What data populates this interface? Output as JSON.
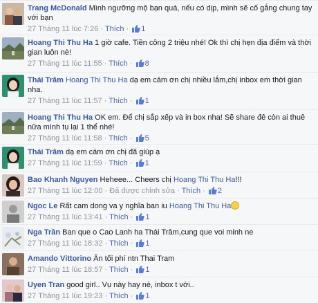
{
  "comments": [
    {
      "author": "Trang McDonald",
      "text": "Mình ngưỡng mộ bạn quá, nếu có dịp, mình sẽ cố gắng chung tay với bạn",
      "timestamp": "27 Tháng 11 lúc 7:26",
      "like_label": "Thích",
      "like_count": "1",
      "avatar_icon": "profile-photo-couple",
      "avatar_color": "#8a5a44"
    },
    {
      "author": "Hoang Thi Thu Ha",
      "text": "1 giờ cafe. Tiền công 2 triệu nhé! Ok thì chị hẹn địa điểm và thời gian luôn nè!",
      "timestamp": "27 Tháng 11 lúc 11:55",
      "like_label": "Thích",
      "like_count": "8",
      "avatar_icon": "profile-photo-landscape",
      "avatar_color": "#6f7f5a"
    },
    {
      "author": "Thái Trâm",
      "mention": "Hoang Thi Thu Ha",
      "text": "dạ em cám ơn chị nhiều lắm,chị inbox em thời gian nha.",
      "timestamp": "27 Tháng 11 lúc 11:57",
      "like_label": "Thích",
      "like_count": "1",
      "avatar_icon": "profile-photo-woman",
      "avatar_color": "#2f8f6f"
    },
    {
      "author": "Hoang Thi Thu Ha",
      "text": "OK em. Để chị sắp xếp và in box nha! Sẽ share đê còn ai thuê nữa mình tụ lại 1 thể nhé!",
      "timestamp": "27 Tháng 11 lúc 11:58",
      "like_label": "Thích",
      "like_count": "5",
      "avatar_icon": "profile-photo-landscape",
      "avatar_color": "#6f7f5a"
    },
    {
      "author": "Thái Trâm",
      "text": "dạ em cám ơn chị đã giúp ạ",
      "timestamp": "27 Tháng 11 lúc 11:59",
      "like_label": "Thích",
      "like_count": "1",
      "avatar_icon": "profile-photo-woman",
      "avatar_color": "#2f8f6f"
    },
    {
      "author": "Bao Khanh Nguyen",
      "text": "Heheee... Cheers chị",
      "mention": "Hoang Thi Thu Ha",
      "text_after": "!!!",
      "timestamp": "27 Tháng 11 lúc 12:00",
      "edited": "Đã được chỉnh sửa",
      "like_label": "Thích",
      "like_count": "2",
      "avatar_icon": "profile-photo-woman-dark",
      "avatar_color": "#3a2a2a"
    },
    {
      "author": "Ngoc Le",
      "text": "Rất cam dong va y nghĩa ban iu",
      "mention": "Hoang Thi Thu Ha",
      "emoji": "smile-emoji",
      "timestamp": "27 Tháng 11 lúc 13:41",
      "like_label": "Thích",
      "like_count": "1",
      "avatar_icon": "profile-photo-grey",
      "avatar_color": "#9a9a9a"
    },
    {
      "author": "Nga Trần",
      "text": "Ban que o Cao Lanh ha Thái Trâm,cung que voi minh ne",
      "timestamp": "27 Tháng 11 lúc 18:32",
      "like_label": "Thích",
      "like_count": "1",
      "avatar_icon": "profile-photo-flowers",
      "avatar_color": "#b7c2d0"
    },
    {
      "author": "Amando Vittorino",
      "text": "Ăn tối phí ntn Thai Tram",
      "timestamp": "27 Tháng 11 lúc 18:57",
      "like_label": "Thích",
      "like_count": "1",
      "avatar_icon": "profile-photo-man",
      "avatar_color": "#5a4030"
    },
    {
      "author": "Uyen Tran",
      "text": "good girl.. Vụ này hay nè, inbox t với..",
      "timestamp": "27 Tháng 11 lúc 19:23",
      "like_label": "Thích",
      "like_count": "1",
      "avatar_icon": "profile-photo-couple-2",
      "avatar_color": "#a0707a"
    }
  ],
  "colors": {
    "link": "#3b5998",
    "meta": "#90949c",
    "background": "#f6f7f9",
    "thumb": "#5b7bd5"
  },
  "icons": {
    "like": "thumbs-up-icon"
  }
}
